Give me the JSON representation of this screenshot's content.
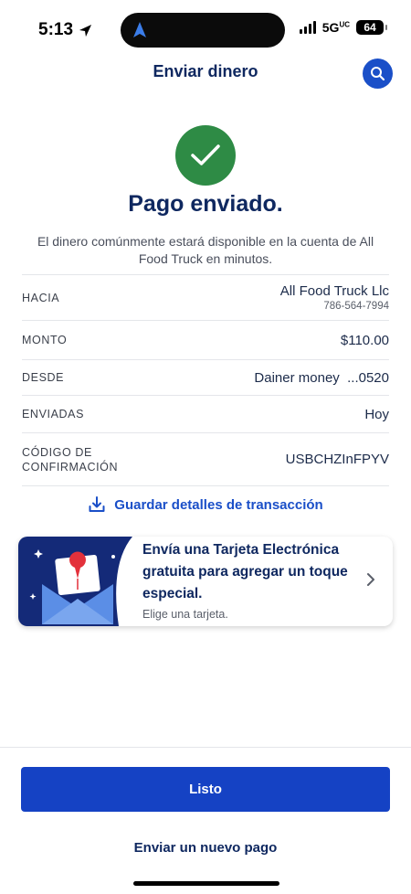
{
  "status_bar": {
    "time": "5:13",
    "network": "5G",
    "network_sup": "UC",
    "battery": "64"
  },
  "header": {
    "title": "Enviar dinero"
  },
  "success": {
    "title": "Pago enviado.",
    "description": "El dinero comúnmente estará disponible en la cuenta de All Food Truck en minutos."
  },
  "details": {
    "to": {
      "label": "HACIA",
      "name": "All Food Truck Llc",
      "phone": "786-564-7994"
    },
    "amount": {
      "label": "MONTO",
      "value": "$110.00"
    },
    "from": {
      "label": "DESDE",
      "value": "Dainer money  ...0520"
    },
    "sent": {
      "label": "ENVIADAS",
      "value": "Hoy"
    },
    "confirmation": {
      "label": "CÓDIGO DE CONFIRMACIÓN",
      "value": "USBCHZInFPYV"
    }
  },
  "save_details_label": "Guardar detalles de transacción",
  "ecard": {
    "title": "Envía una Tarjeta Electrónica gratuita para agregar un toque especial.",
    "subtitle": "Elige una tarjeta."
  },
  "actions": {
    "done_label": "Listo",
    "new_payment_label": "Enviar un nuevo pago"
  },
  "colors": {
    "primary": "#1542c4",
    "success": "#2e8b45",
    "navy": "#0f2860"
  }
}
